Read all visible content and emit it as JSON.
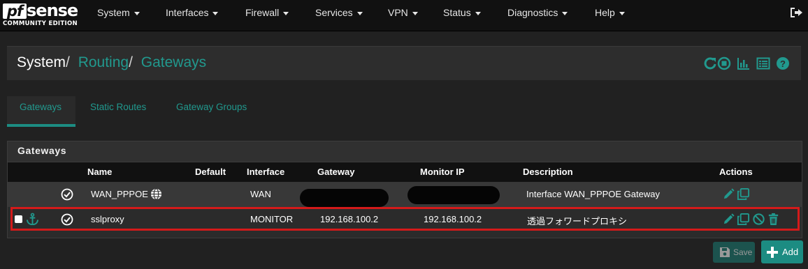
{
  "brand": {
    "logo_pf": "pf",
    "logo_sense": "sense",
    "logo_sub": "COMMUNITY EDITION"
  },
  "nav": {
    "items": [
      "System",
      "Interfaces",
      "Firewall",
      "Services",
      "VPN",
      "Status",
      "Diagnostics",
      "Help"
    ]
  },
  "breadcrumb": {
    "root": "System",
    "sep": "/",
    "level1": "Routing",
    "level2": "Gateways",
    "icons": [
      "refresh-icon",
      "stop-icon",
      "chart-icon",
      "list-icon",
      "help-icon"
    ]
  },
  "tabs": [
    {
      "label": "Gateways",
      "active": true
    },
    {
      "label": "Static Routes",
      "active": false
    },
    {
      "label": "Gateway Groups",
      "active": false
    }
  ],
  "panel": {
    "title": "Gateways",
    "columns": [
      "Name",
      "Default",
      "Interface",
      "Gateway",
      "Monitor IP",
      "Description",
      "Actions"
    ],
    "rows": [
      {
        "name": "WAN_PPPOE",
        "default": "",
        "interface": "WAN",
        "gateway": "",
        "monitor_ip": "",
        "description": "Interface WAN_PPPOE Gateway",
        "actions": [
          "edit-icon",
          "copy-icon"
        ]
      },
      {
        "name": "sslproxy",
        "default": "",
        "interface": "MONITOR",
        "gateway": "192.168.100.2",
        "monitor_ip": "192.168.100.2",
        "description": "透過フォワードプロキシ",
        "actions": [
          "edit-icon",
          "copy-icon",
          "disable-icon",
          "delete-icon"
        ]
      }
    ]
  },
  "buttons": {
    "save": "Save",
    "add": "Add"
  },
  "colors": {
    "accent": "#21998e",
    "highlight": "#d41a1a",
    "navbar": "#111111",
    "background": "#212121"
  }
}
